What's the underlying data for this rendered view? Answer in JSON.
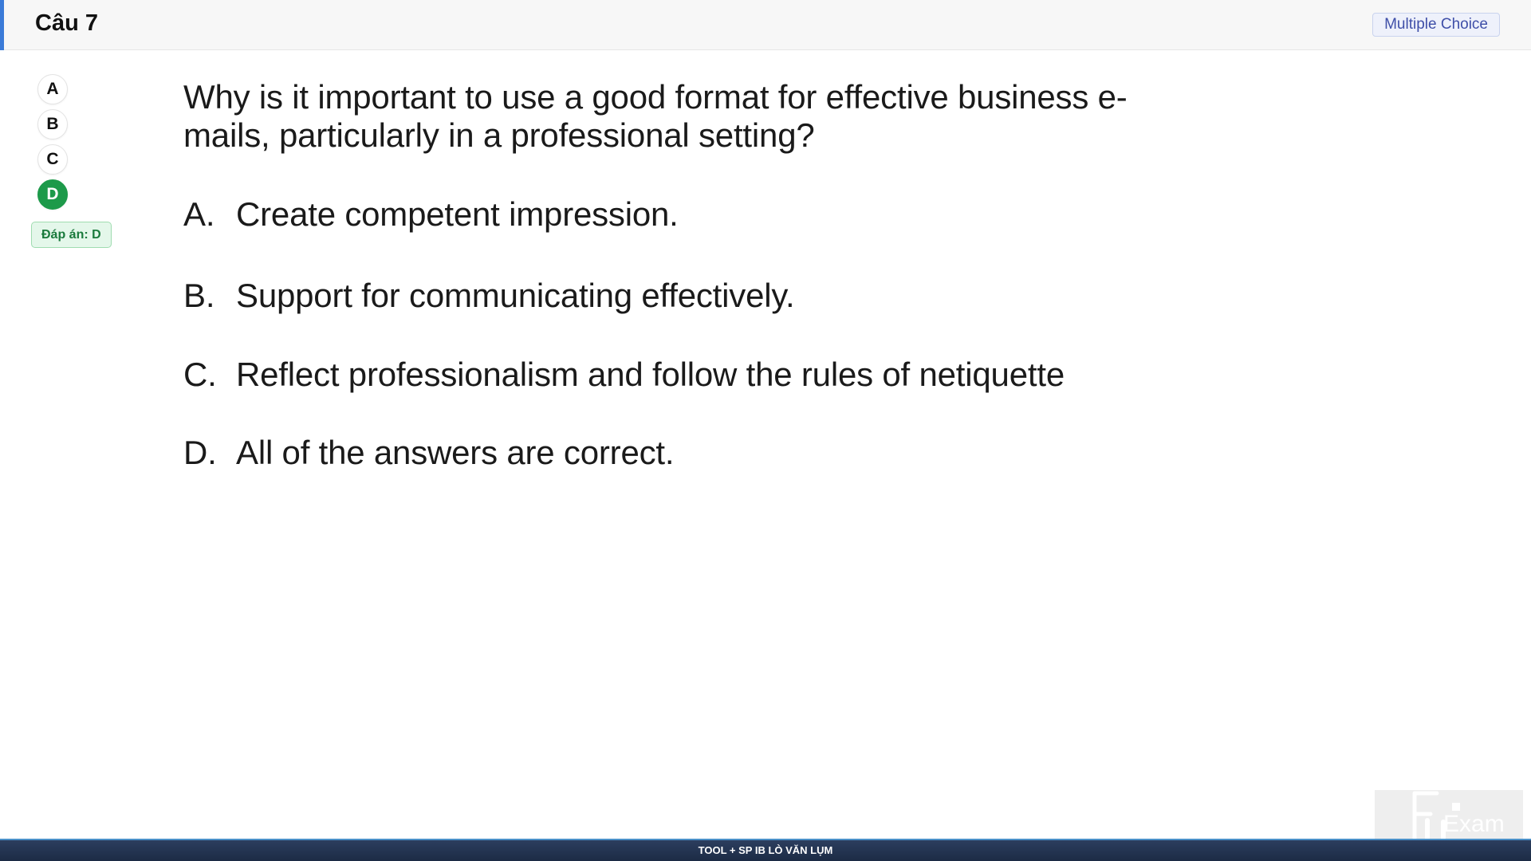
{
  "header": {
    "question_number": "Câu 7",
    "question_type": "Multiple Choice"
  },
  "choices": [
    {
      "label": "A",
      "selected": false
    },
    {
      "label": "B",
      "selected": false
    },
    {
      "label": "C",
      "selected": false
    },
    {
      "label": "D",
      "selected": true
    }
  ],
  "answer_badge": "Đáp án: D",
  "question": {
    "text": "Why is it important to use a good format for effective business e-mails, particularly in a professional setting?",
    "options": [
      {
        "letter": "A.",
        "text": "Create competent impression."
      },
      {
        "letter": "B.",
        "text": "Support for communicating effectively."
      },
      {
        "letter": "C.",
        "text": "Reflect professionalism and follow the rules of netiquette"
      },
      {
        "letter": "D.",
        "text": "All of the answers are correct."
      }
    ]
  },
  "footer": {
    "text": "TOOL + SP IB LÒ VĂN LỤM"
  },
  "logo": {
    "text": "Exam",
    "icon": "fu-exam-logo-icon"
  },
  "colors": {
    "accent": "#3b7bd8",
    "selected": "#1d9a4a",
    "footer_bg": "#1c2b45"
  }
}
